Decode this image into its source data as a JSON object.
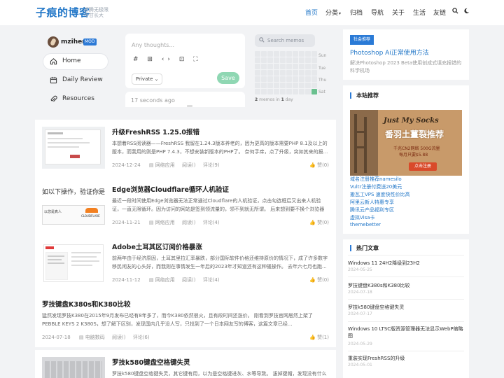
{
  "header": {
    "logo": "子痕的博客",
    "tagline_1": "折腾无极限",
    "tagline_2": "不甘长大",
    "nav": [
      "首页",
      "分类",
      "归档",
      "导航",
      "关于",
      "生活",
      "友链"
    ],
    "nav_caret": "▾",
    "icons": [
      "search-icon",
      "moon-icon"
    ]
  },
  "memos": {
    "username": "mzihen",
    "badge": "MOD",
    "menu": [
      {
        "label": "Home",
        "icon": "home-icon"
      },
      {
        "label": "Daily Review",
        "icon": "calendar-icon"
      },
      {
        "label": "Resources",
        "icon": "paperclip-icon"
      }
    ],
    "editor_placeholder": "Any thoughts...",
    "editor_tools": "# ⊞ ‹› ⊡ ⛶",
    "privacy": "Private ⌄",
    "save": "Save",
    "last_time": "17 seconds ago",
    "search_placeholder": "Search memos",
    "days": [
      "Sun",
      "Tue",
      "Thu",
      "Sat"
    ],
    "stat_prefix": "2",
    "stat_mid": " memos in ",
    "stat_days": "1",
    "stat_suffix": " day"
  },
  "posts": [
    {
      "title": "升级FreshRSS 1.25.0报错",
      "desc": "本想着RSS阅读器——FreshRSS 我留在1.24.3版本养老的，因为更高的版本需要PHP 8.1及以上的版本，而我用的则是PHP 7.4.3，不想安装新版本的PHP了。 奈何手痒，点了升级，突如其来的报...",
      "date": "2024-12-24",
      "cat": "网络应用",
      "views": "阅读()",
      "comments": "评论(9)",
      "likes": "赞(0)"
    },
    {
      "title": "Edge浏览器Cloudflare循环人机验证",
      "desc": "最近一段时间使用Edge浏览器无法正常通过Cloudflare的人机验证，点击勾选框后又出来人机验证，一直无限循环。因为访问的网站是签到领流量的，领不到就无所谓。 后来想到要不换个浏览器试试...",
      "date": "2024-11-21",
      "cat": "网络应用",
      "views": "阅读()",
      "comments": "评论(4)",
      "likes": "赞(0)"
    },
    {
      "title": "Adobe土耳其区订阅价格暴涨",
      "desc": "前两年由于经济原因，土耳其里拉汇率暴跌，部分国际软件价格还维持原价的情况下，成了许多数字移民闲友的心头好，而我则在事情发生一年后的2023年才知道还有这种骚操作。 去年六七月也跑...",
      "date": "2024-11-12",
      "cat": "网络应用",
      "views": "阅读()",
      "comments": "评论(4)",
      "likes": "赞(0)"
    },
    {
      "title": "罗技键盘K380s和K380比较",
      "desc": "猛然发现罗技K380在2015年9月发布已经有8年多了，而今K380依然很火，且有段时间还涨价。 刚看到罗技官网居然上架了 PEBBLE KEYS 2 K380S，想了解下区别，发现国内几乎没人写，只找到了一个日本网友写的博客，这篇文章已经...",
      "date": "2024-07-18",
      "cat": "电脑数码",
      "views": "阅读()",
      "comments": "评论(6)",
      "likes": "赞(1)"
    },
    {
      "title": "罗技k580键盘空格键失灵",
      "desc": "罗技k580键盘空格键失灵，其它键有用，以为是空格键进灰、水等导致。 拔掉键帽，发现没有什么",
      "date": "",
      "cat": "",
      "views": "",
      "comments": "",
      "likes": ""
    }
  ],
  "thumb_texts": {
    "post2_left": "如以下操作，验证你是真",
    "post2_small": "以您是真人",
    "post2_brand": "CLOUDFLARE"
  },
  "sidebar": {
    "ad_tag": "社会推荐",
    "ad_title": "Photoshop Ai正常使用方法",
    "ad_desc": "解决Photoshop 2023 Beta使用创成式填充报错的科学机场",
    "rec_title": "本站推荐",
    "banner_brand": "Just My Socks",
    "banner_line1": "番羽土薑裂推荐",
    "banner_line2": "千兆CN2网络 500G流量",
    "banner_line3": "每月只要$5.88",
    "banner_btn": "点击注册",
    "links": [
      "域名注册推荐namesilo",
      "Vultr注册付费送20美元",
      "搬瓦工VPS 速度快性价比高",
      "阿里云新人特惠专享",
      "腾讯云产品福利专区",
      "虚拟Visa卡",
      "themebetter"
    ],
    "hot_title": "热门文章",
    "hot": [
      {
        "title": "Windows 11 24H2降级到23H2",
        "date": "2024-05-25"
      },
      {
        "title": "罗技键盘K380s和K380比较",
        "date": "2024-07-18"
      },
      {
        "title": "罗技k580键盘空格键失灵",
        "date": "2024-07-17"
      },
      {
        "title": "Windows 10 LTSC版资源管理器无法显示WebP缩略图",
        "date": "2024-05-29"
      },
      {
        "title": "重装实现FreshRSS的升级",
        "date": "2024-05-01"
      }
    ]
  }
}
